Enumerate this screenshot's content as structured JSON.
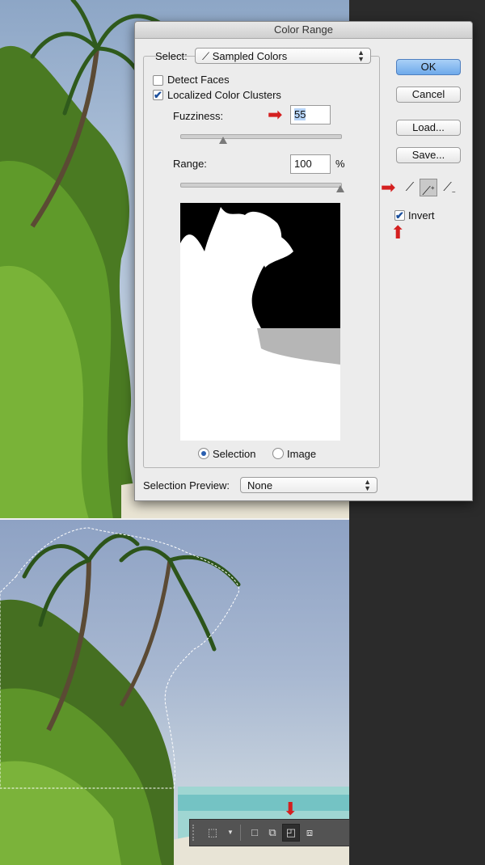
{
  "dialog": {
    "title": "Color Range",
    "select_label": "Select:",
    "select_value": "Sampled Colors",
    "detect_faces_label": "Detect Faces",
    "detect_faces_checked": false,
    "localized_label": "Localized Color Clusters",
    "localized_checked": true,
    "fuzziness_label": "Fuzziness:",
    "fuzziness_value": "55",
    "fuzziness_level": 0.27,
    "range_label": "Range:",
    "range_value": "100",
    "range_unit": "%",
    "range_level": 1.0,
    "view_options": [
      {
        "label": "Selection",
        "selected": true
      },
      {
        "label": "Image",
        "selected": false
      }
    ],
    "preview_label": "Selection Preview:",
    "preview_value": "None",
    "buttons": {
      "ok": "OK",
      "cancel": "Cancel",
      "load": "Load...",
      "save": "Save..."
    },
    "eyedroppers": [
      "eyedropper-icon",
      "eyedropper-plus-icon",
      "eyedropper-minus-icon"
    ],
    "invert_label": "Invert",
    "invert_checked": true
  },
  "annotation_color": "#d41f1f",
  "toolbar_icons": [
    "rect-marquee-icon",
    "dropdown-icon",
    "new-selection-icon",
    "add-selection-icon",
    "subtract-selection-icon",
    "intersect-selection-icon"
  ]
}
